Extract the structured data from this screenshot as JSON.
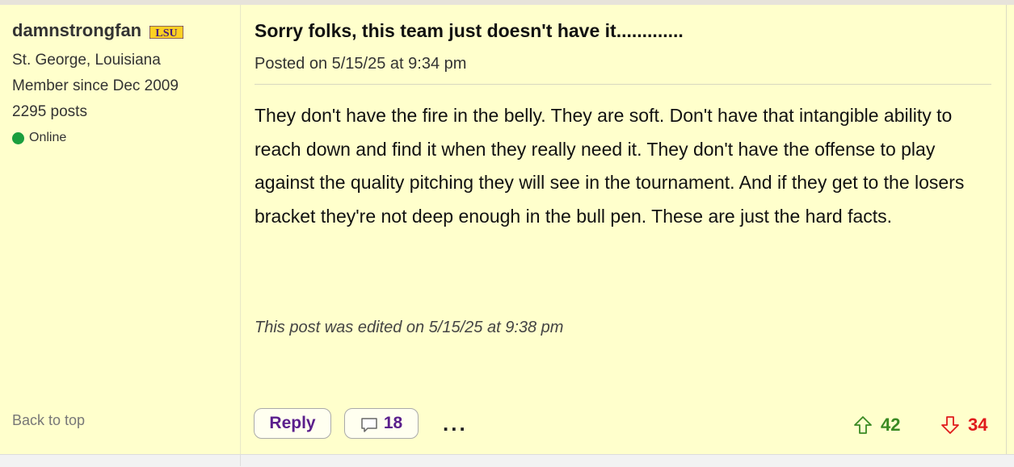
{
  "author": {
    "username": "damnstrongfan",
    "team_logo_text": "LSU",
    "location": "St. George, Louisiana",
    "member_since": "Member since Dec 2009",
    "posts": "2295 posts",
    "status": "Online",
    "status_color": "#1a9e3e"
  },
  "post": {
    "title": "Sorry folks, this team just doesn't have it.............",
    "posted_on": "Posted on 5/15/25 at 9:34 pm",
    "body": "They don't have the fire in the belly. They are soft. Don't have that intangible ability to reach down and find it when they really need it. They don't have the offense to play against the quality pitching they will see in the tournament. And if they get to the losers bracket they're not deep enough in the bull pen. These are just the hard facts.",
    "edited_note": "This post was edited on 5/15/25 at 9:38 pm"
  },
  "actions": {
    "back_to_top": "Back to top",
    "reply_label": "Reply",
    "comment_count": "18",
    "more_label": "...",
    "upvotes": "42",
    "downvotes": "34"
  },
  "colors": {
    "background": "#ffffcc",
    "action_text": "#5a1e8c",
    "upvote": "#3a8a23",
    "downvote": "#e01b1b"
  },
  "icons": [
    "lsu-logo-icon",
    "online-dot-icon",
    "comment-bubble-icon",
    "arrow-up-icon",
    "arrow-down-icon"
  ]
}
